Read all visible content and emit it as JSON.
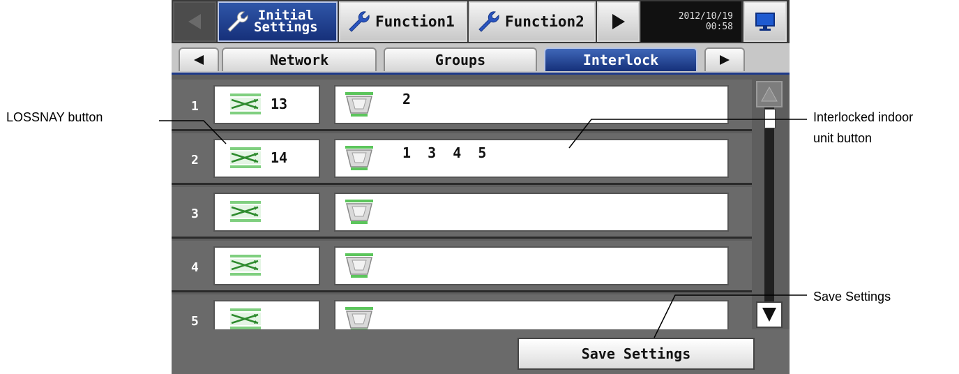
{
  "callouts": {
    "lossnay": "LOSSNAY button",
    "interlocked_l1": "Interlocked indoor",
    "interlocked_l2": "unit button",
    "save": "Save Settings"
  },
  "topbar": {
    "initial_l1": "Initial",
    "initial_l2": "Settings",
    "function1": "Function1",
    "function2": "Function2",
    "date": "2012/10/19",
    "time": "00:58",
    "prev_icon": "left-arrow-icon",
    "next_icon": "right-arrow-icon",
    "monitor_icon": "monitor-icon"
  },
  "tabs": {
    "network": "Network",
    "groups": "Groups",
    "interlock": "Interlock"
  },
  "rows": [
    {
      "index": "1",
      "lossnay": "13",
      "indoor": "2"
    },
    {
      "index": "2",
      "lossnay": "14",
      "indoor": "1  3  4  5"
    },
    {
      "index": "3",
      "lossnay": "",
      "indoor": ""
    },
    {
      "index": "4",
      "lossnay": "",
      "indoor": ""
    },
    {
      "index": "5",
      "lossnay": "",
      "indoor": ""
    }
  ],
  "save_label": "Save Settings",
  "colors": {
    "active_tab": "#1e3a8a",
    "screen_bg": "#5e5e5e"
  }
}
